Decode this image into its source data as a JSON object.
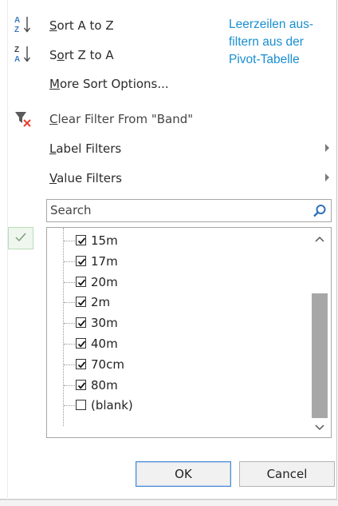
{
  "menu": {
    "sort_az": {
      "pre": "",
      "accel": "S",
      "post": "ort A to Z",
      "icon": "sort-az-icon"
    },
    "sort_za": {
      "pre": "S",
      "accel": "o",
      "post": "rt Z to A",
      "icon": "sort-za-icon"
    },
    "more_sort": {
      "pre": "",
      "accel": "M",
      "post": "ore Sort Options..."
    },
    "clear_filter": {
      "pre": "",
      "accel": "C",
      "post": "lear Filter From \"Band\"",
      "icon": "clear-filter-icon"
    },
    "label_filters": {
      "pre": "",
      "accel": "L",
      "post": "abel Filters"
    },
    "value_filters": {
      "pre": "",
      "accel": "V",
      "post": "alue Filters"
    }
  },
  "annotation": {
    "line1": "Leerzeilen aus-",
    "line2": "filtern aus der",
    "line3": "Pivot-Tabelle"
  },
  "search": {
    "placeholder": "Search"
  },
  "list": {
    "items": [
      {
        "label": "15m",
        "checked": true
      },
      {
        "label": "17m",
        "checked": true
      },
      {
        "label": "20m",
        "checked": true
      },
      {
        "label": "2m",
        "checked": true
      },
      {
        "label": "30m",
        "checked": true
      },
      {
        "label": "40m",
        "checked": true
      },
      {
        "label": "70cm",
        "checked": true
      },
      {
        "label": "80m",
        "checked": true
      },
      {
        "label": "(blank)",
        "checked": false
      }
    ]
  },
  "buttons": {
    "ok": "OK",
    "cancel": "Cancel"
  },
  "colors": {
    "accent": "#1a8fd0",
    "ok_border": "#4a8bd3",
    "clear_x": "#e8402f"
  }
}
